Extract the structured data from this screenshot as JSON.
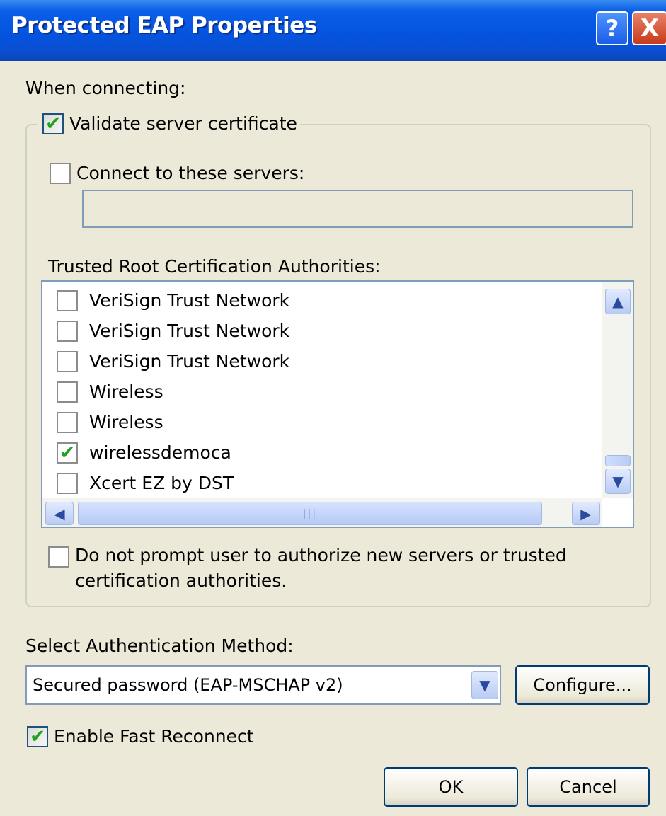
{
  "window": {
    "title": "Protected EAP Properties",
    "help_glyph": "?",
    "close_glyph": "X"
  },
  "when_connecting_label": "When connecting:",
  "validate_server_certificate": {
    "label": "Validate server certificate",
    "checked": true
  },
  "connect_to_servers": {
    "label": "Connect to these servers:",
    "checked": false,
    "value": ""
  },
  "trusted_root_label": "Trusted Root Certification Authorities:",
  "ca_list": [
    {
      "label": "VeriSign Trust Network",
      "checked": false
    },
    {
      "label": "VeriSign Trust Network",
      "checked": false
    },
    {
      "label": "VeriSign Trust Network",
      "checked": false
    },
    {
      "label": "Wireless",
      "checked": false
    },
    {
      "label": "Wireless",
      "checked": false
    },
    {
      "label": "wirelessdemoca",
      "checked": true
    },
    {
      "label": "Xcert EZ by DST",
      "checked": false
    }
  ],
  "do_not_prompt": {
    "label_line1": "Do not prompt user to authorize new servers or trusted",
    "label_line2": "certification authorities.",
    "checked": false
  },
  "select_auth_method_label": "Select Authentication Method:",
  "auth_method": {
    "selected": "Secured password (EAP-MSCHAP v2)"
  },
  "configure_label": "Configure...",
  "enable_fast_reconnect": {
    "label": "Enable Fast Reconnect",
    "checked": true
  },
  "ok_label": "OK",
  "cancel_label": "Cancel",
  "icons": {
    "check": "✔",
    "up": "▲",
    "down": "▼",
    "left": "◀",
    "right": "▶",
    "grip": "|||"
  }
}
